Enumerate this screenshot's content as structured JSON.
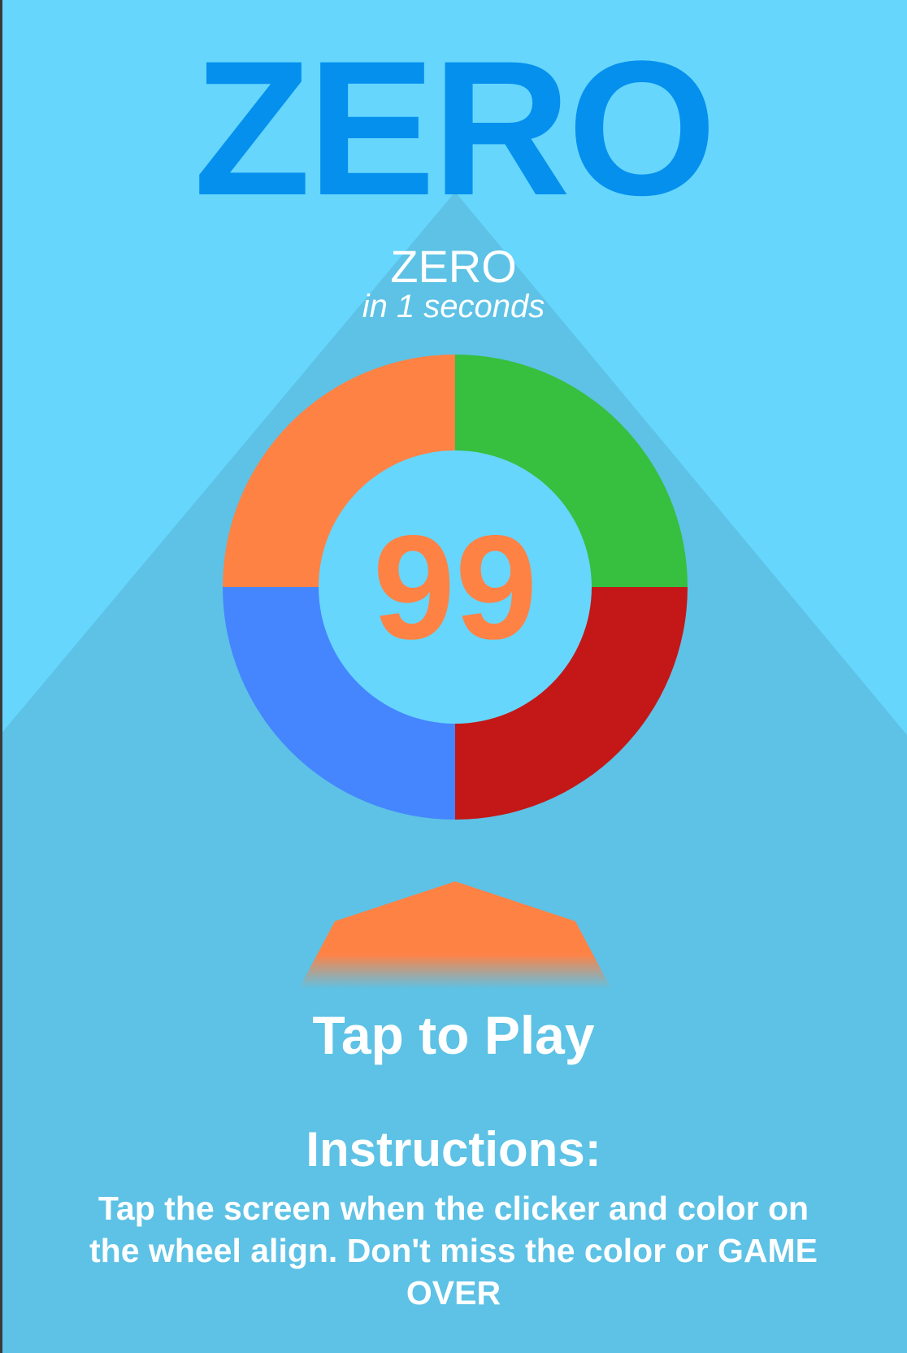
{
  "colors": {
    "sky": "#66D6FD",
    "shadow": "#5DC2E5",
    "title": "#0590EE",
    "text": "#FFFFFF",
    "orange": "#FF8245",
    "green": "#37BF3F",
    "red": "#C41818",
    "blue": "#4585FE",
    "edge": "#3A3A3A"
  },
  "title": "ZERO",
  "subtitle": "ZERO",
  "subtitle_caption": "in 1 seconds",
  "wheel": {
    "segments": [
      {
        "name": "green",
        "color": "#37BF3F"
      },
      {
        "name": "red",
        "color": "#C41818"
      },
      {
        "name": "blue",
        "color": "#4585FE"
      },
      {
        "name": "orange",
        "color": "#FF8245"
      }
    ],
    "counter": "99",
    "counter_color": "#FF8245"
  },
  "clicker": {
    "color": "#FF8245"
  },
  "play_prompt": "Tap to Play",
  "instructions": {
    "heading": "Instructions:",
    "body": "Tap the screen when the clicker and color on the wheel align. Don't miss the color or GAME OVER"
  }
}
